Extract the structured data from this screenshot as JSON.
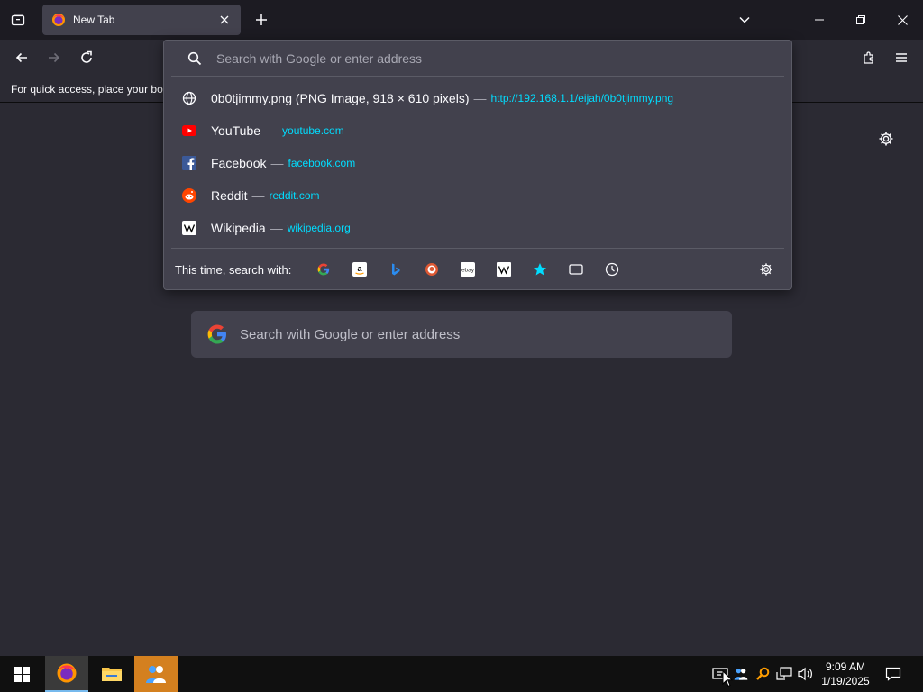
{
  "tab": {
    "title": "New Tab"
  },
  "bookmarks_bar": {
    "text": "For quick access, place your boo"
  },
  "urlbar": {
    "placeholder": "Search with Google or enter address"
  },
  "results": [
    {
      "icon": "globe-icon",
      "title": "0b0tjimmy.png (PNG Image, 918 × 610 pixels)",
      "sep": "—",
      "url": "http://192.168.1.1/eijah/0b0tjimmy.png"
    },
    {
      "icon": "youtube-icon",
      "title": "YouTube",
      "sep": "—",
      "url": "youtube.com"
    },
    {
      "icon": "facebook-icon",
      "title": "Facebook",
      "sep": "—",
      "url": "facebook.com"
    },
    {
      "icon": "reddit-icon",
      "title": "Reddit",
      "sep": "—",
      "url": "reddit.com"
    },
    {
      "icon": "wikipedia-icon",
      "title": "Wikipedia",
      "sep": "—",
      "url": "wikipedia.org"
    }
  ],
  "oneoff": {
    "label": "This time, search with:",
    "engines": [
      "google-icon",
      "amazon-icon",
      "bing-icon",
      "duckduckgo-icon",
      "ebay-icon",
      "wikipedia-icon",
      "bookmarks-star-icon",
      "tabs-icon",
      "history-icon"
    ]
  },
  "content_search": {
    "placeholder": "Search with Google or enter address"
  },
  "clock": {
    "time": "9:09 AM",
    "date": "1/19/2025"
  },
  "colors": {
    "accent": "#00ddff",
    "surface": "#42414d",
    "background": "#2b2a33",
    "tabstrip": "#1c1b22"
  }
}
